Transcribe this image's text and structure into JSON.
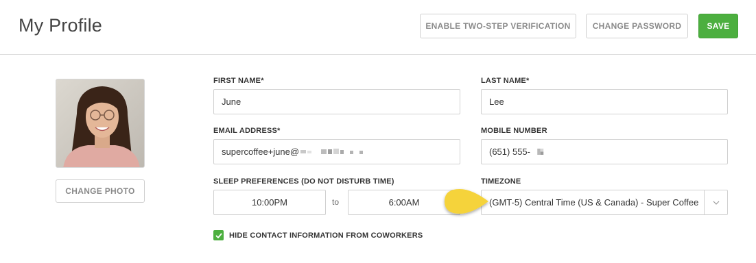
{
  "header": {
    "title": "My Profile",
    "enable_2fa_label": "ENABLE TWO-STEP VERIFICATION",
    "change_password_label": "CHANGE PASSWORD",
    "save_label": "SAVE"
  },
  "photo": {
    "change_photo_label": "CHANGE PHOTO"
  },
  "form": {
    "first_name": {
      "label": "FIRST NAME*",
      "value": "June"
    },
    "last_name": {
      "label": "LAST NAME*",
      "value": "Lee"
    },
    "email": {
      "label": "EMAIL ADDRESS*",
      "value": "supercoffee+june@"
    },
    "mobile": {
      "label": "MOBILE NUMBER",
      "value": "(651) 555-"
    },
    "sleep": {
      "label": "SLEEP PREFERENCES (DO NOT DISTURB TIME)",
      "start": "10:00PM",
      "separator": "to",
      "end": "6:00AM"
    },
    "timezone": {
      "label": "TIMEZONE",
      "value": "(GMT-5) Central Time (US & Canada) - Super Coffee"
    },
    "hide_contact": {
      "label": "HIDE CONTACT INFORMATION FROM COWORKERS",
      "checked": true
    }
  },
  "colors": {
    "accent": "#4caf3f",
    "pointer": "#f5d33a"
  },
  "icons": {
    "select_arrow": "chevron-down-icon",
    "checkbox_check": "checkmark-icon",
    "pointer": "pointer-arrow-icon"
  }
}
